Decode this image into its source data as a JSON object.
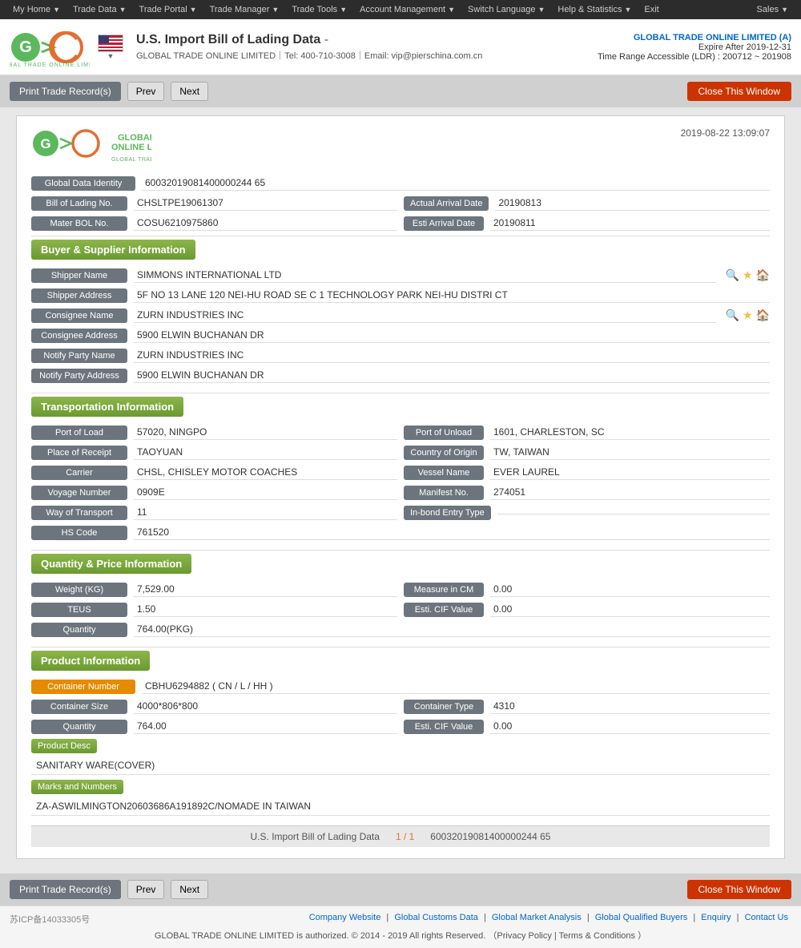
{
  "nav": {
    "items": [
      {
        "label": "My Home",
        "arrow": true
      },
      {
        "label": "Trade Data",
        "arrow": true
      },
      {
        "label": "Trade Portal",
        "arrow": true
      },
      {
        "label": "Trade Manager",
        "arrow": true
      },
      {
        "label": "Trade Tools",
        "arrow": true
      },
      {
        "label": "Account Management",
        "arrow": true
      },
      {
        "label": "Switch Language",
        "arrow": true
      },
      {
        "label": "Help & Statistics",
        "arrow": true
      },
      {
        "label": "Exit",
        "arrow": false
      }
    ],
    "sales": "Sales"
  },
  "header": {
    "title": "U.S. Import Bill of Lading Data",
    "subtitle": "GLOBAL TRADE ONLINE LIMITED｜Tel: 400-710-3008｜Email: vip@pierschina.com.cn",
    "company_name": "GLOBAL TRADE ONLINE LIMITED (A)",
    "expire": "Expire After 2019-12-31",
    "ldr": "Time Range Accessible (LDR) : 200712 ~ 201908"
  },
  "actions": {
    "print": "Print Trade Record(s)",
    "prev": "Prev",
    "next": "Next",
    "close": "Close This Window"
  },
  "record": {
    "timestamp": "2019-08-22 13:09:07",
    "global_data_identity_label": "Global Data Identity",
    "global_data_identity": "60032019081400000244 65",
    "bill_of_lading_no_label": "Bill of Lading No.",
    "bill_of_lading_no": "CHSLTPE19061307",
    "actual_arrival_date_label": "Actual Arrival Date",
    "actual_arrival_date": "20190813",
    "mater_bol_no_label": "Mater BOL No.",
    "mater_bol_no": "COSU6210975860",
    "esti_arrival_date_label": "Esti Arrival Date",
    "esti_arrival_date": "20190811"
  },
  "buyer_supplier": {
    "section_label": "Buyer & Supplier Information",
    "shipper_name_label": "Shipper Name",
    "shipper_name": "SIMMONS INTERNATIONAL LTD",
    "shipper_address_label": "Shipper Address",
    "shipper_address": "5F NO 13 LANE 120 NEI-HU ROAD SE C 1 TECHNOLOGY PARK NEI-HU DISTRI CT",
    "consignee_name_label": "Consignee Name",
    "consignee_name": "ZURN INDUSTRIES INC",
    "consignee_address_label": "Consignee Address",
    "consignee_address": "5900 ELWIN BUCHANAN DR",
    "notify_party_name_label": "Notify Party Name",
    "notify_party_name": "ZURN INDUSTRIES INC",
    "notify_party_address_label": "Notify Party Address",
    "notify_party_address": "5900 ELWIN BUCHANAN DR"
  },
  "transportation": {
    "section_label": "Transportation Information",
    "port_of_load_label": "Port of Load",
    "port_of_load": "57020, NINGPO",
    "port_of_unload_label": "Port of Unload",
    "port_of_unload": "1601, CHARLESTON, SC",
    "place_of_receipt_label": "Place of Receipt",
    "place_of_receipt": "TAOYUAN",
    "country_of_origin_label": "Country of Origin",
    "country_of_origin": "TW, TAIWAN",
    "carrier_label": "Carrier",
    "carrier": "CHSL, CHISLEY MOTOR COACHES",
    "vessel_name_label": "Vessel Name",
    "vessel_name": "EVER LAUREL",
    "voyage_number_label": "Voyage Number",
    "voyage_number": "0909E",
    "manifest_no_label": "Manifest No.",
    "manifest_no": "274051",
    "way_of_transport_label": "Way of Transport",
    "way_of_transport": "11",
    "inbond_entry_type_label": "In-bond Entry Type",
    "inbond_entry_type": "",
    "hs_code_label": "HS Code",
    "hs_code": "761520"
  },
  "quantity_price": {
    "section_label": "Quantity & Price Information",
    "weight_label": "Weight (KG)",
    "weight": "7,529.00",
    "measure_in_cm_label": "Measure in CM",
    "measure_in_cm": "0.00",
    "teus_label": "TEUS",
    "teus": "1.50",
    "esti_cif_value_label": "Esti. CIF Value",
    "esti_cif_value": "0.00",
    "quantity_label": "Quantity",
    "quantity": "764.00(PKG)"
  },
  "product": {
    "section_label": "Product Information",
    "container_number_label": "Container Number",
    "container_number": "CBHU6294882 ( CN / L / HH )",
    "container_size_label": "Container Size",
    "container_size": "4000*806*800",
    "container_type_label": "Container Type",
    "container_type": "4310",
    "quantity_label": "Quantity",
    "quantity": "764.00",
    "esti_cif_value_label": "Esti. CIF Value",
    "esti_cif_value": "0.00",
    "product_desc_label": "Product Desc",
    "product_desc": "SANITARY WARE(COVER)",
    "marks_label": "Marks and Numbers",
    "marks": "ZA-ASWILMINGTON20603686A191892C/NOMADE IN TAIWAN"
  },
  "pagination": {
    "current": "1 / 1",
    "record_id": "60032019081400000244 65"
  },
  "footer": {
    "icp": "苏ICP备14033305号",
    "links": [
      "Company Website",
      "Global Customs Data",
      "Global Market Analysis",
      "Global Qualified Buyers",
      "Enquiry",
      "Contact Us"
    ],
    "copyright": "GLOBAL TRADE ONLINE LIMITED is authorized. © 2014 - 2019 All rights Reserved. （Privacy Policy | Terms & Conditions ）"
  }
}
